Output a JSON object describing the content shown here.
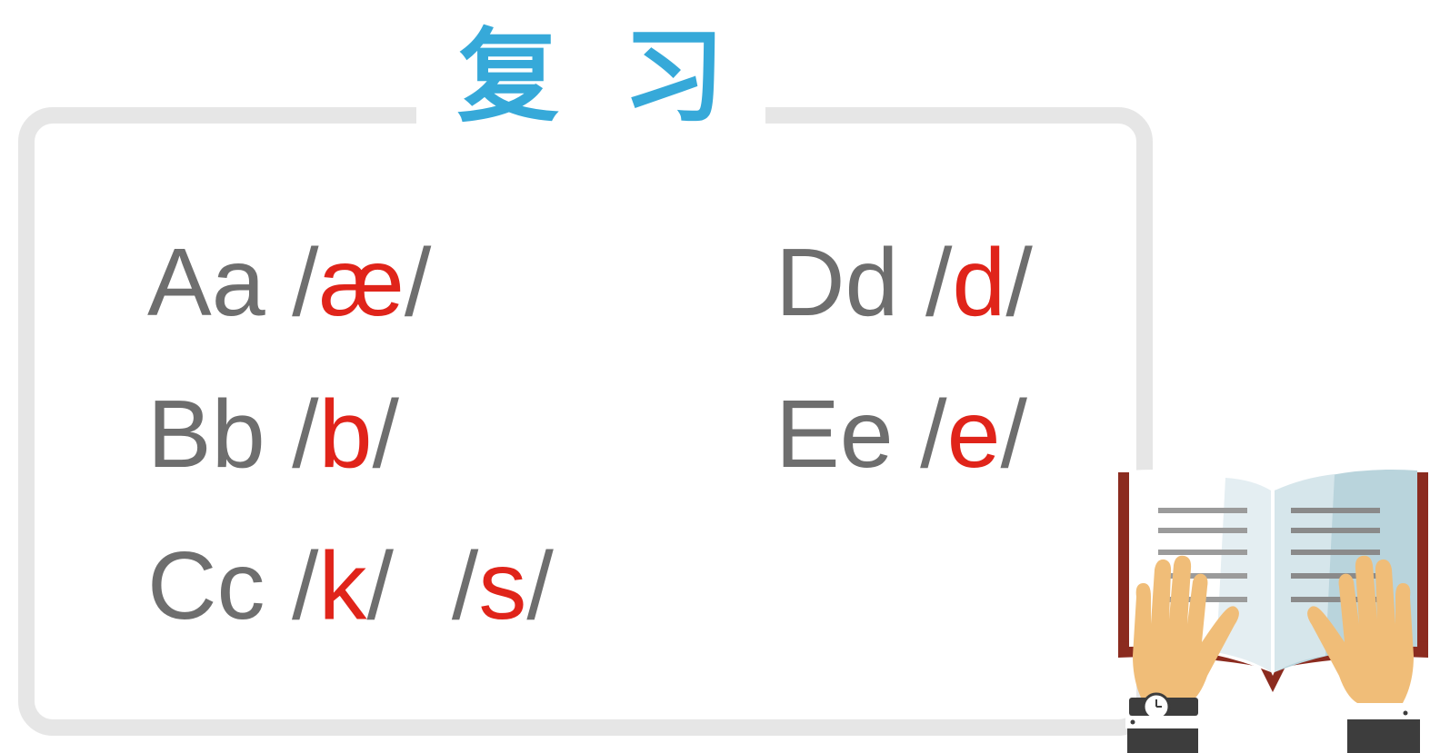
{
  "title": {
    "char1": "复",
    "char2": "习"
  },
  "entries": [
    {
      "letter": "Aa",
      "sounds": [
        "æ"
      ]
    },
    {
      "letter": "Bb",
      "sounds": [
        "b"
      ]
    },
    {
      "letter": "Cc",
      "sounds": [
        "k",
        "s"
      ]
    },
    {
      "letter": "Dd",
      "sounds": [
        "d"
      ]
    },
    {
      "letter": "Ee",
      "sounds": [
        "e"
      ]
    }
  ],
  "slash": "/",
  "colors": {
    "title": "#36a9d9",
    "letter": "#6e6e6e",
    "phoneme": "#e0241a",
    "frame": "#e6e6e6"
  },
  "illustration": "open-book-with-hands"
}
